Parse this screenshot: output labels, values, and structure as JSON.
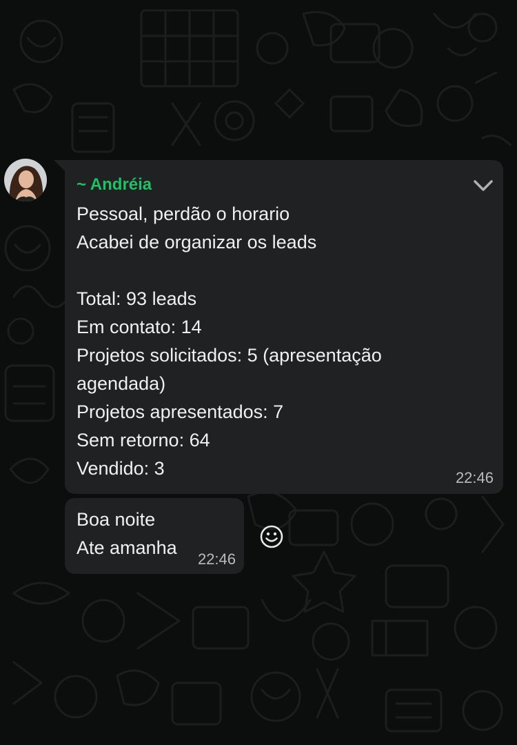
{
  "messages": [
    {
      "sender": "~ Andréia",
      "lines": [
        "Pessoal, perdão o horario",
        "Acabei de organizar os leads",
        "",
        "Total: 93 leads",
        "Em contato: 14",
        "Projetos solicitados: 5 (apresentação",
        "agendada)",
        "Projetos apresentados: 7",
        "Sem retorno: 64",
        "Vendido: 3"
      ],
      "time": "22:46"
    },
    {
      "lines": [
        "Boa noite",
        "Ate amanha"
      ],
      "time": "22:46"
    }
  ],
  "icons": {
    "message_menu": "chevron-down-icon",
    "react": "smiley-face-icon"
  },
  "colors": {
    "background": "#0c0d0d",
    "bubble": "#1f2122",
    "sender_name": "#21c063",
    "text": "#eef0f1",
    "timestamp": "#b9bcbe"
  }
}
